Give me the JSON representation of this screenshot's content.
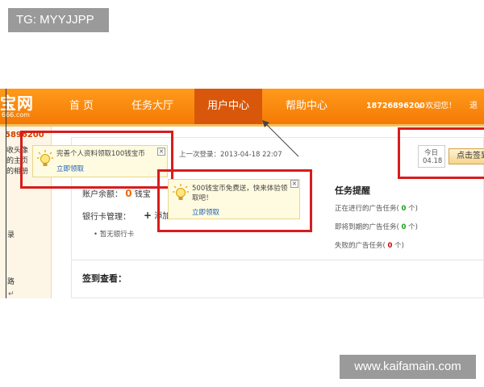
{
  "watermarks": {
    "top": "TG: MYYJJPP",
    "bottom": "www.kaifamain.com"
  },
  "site": {
    "logo": "宝网",
    "logo_sub": "666.com"
  },
  "nav": {
    "items": [
      {
        "label": "首 页"
      },
      {
        "label": "任务大厅"
      },
      {
        "label": "用户中心"
      },
      {
        "label": "帮助中心"
      }
    ],
    "phone": "18726896200",
    "welcome": "欢迎您",
    "exit": "退出"
  },
  "sidebar": {
    "number": "5896200",
    "lines": [
      "收头像",
      "的主页",
      "的相册"
    ],
    "lower_1": "录",
    "lower_2": "路"
  },
  "account": {
    "last_login_label": "上一次登录：",
    "last_login_time": "2013-04-18 22:07",
    "balance_label": "账户余额：",
    "balance_value": "0",
    "balance_unit": "钱宝",
    "bank_label": "银行卡管理：",
    "bank_add": "添加",
    "no_bank": "暂无银行卡",
    "checkin_title": "签到查看："
  },
  "task_reminder": {
    "title": "任务提醒",
    "rows": [
      {
        "label": "正在进行的广告任务(",
        "count": "0",
        "suffix": "个)"
      },
      {
        "label": "即将到期的广告任务(",
        "count": "0",
        "suffix": "个)"
      },
      {
        "label": "失败的广告任务(",
        "count": "0",
        "suffix": "个)"
      }
    ]
  },
  "tips": {
    "profile": {
      "text": "完善个人资料领取100钱宝币",
      "link": "立即领取"
    },
    "trial": {
      "text": "500钱宝币免费送，快来体验领取吧！",
      "link": "立即领取"
    }
  },
  "checkin": {
    "today_label": "今日",
    "date": "04.18",
    "button": "点击签到"
  },
  "colors": {
    "nav_orange": "#f47a06",
    "highlight_red": "#d81c1c",
    "count_green": "#19a019"
  }
}
